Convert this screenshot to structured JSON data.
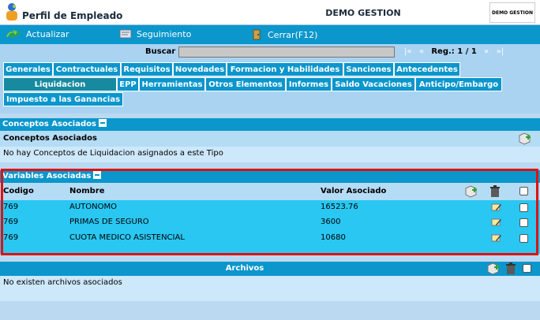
{
  "header": {
    "title": "Perfil de Empleado",
    "company": "DEMO GESTION",
    "brand_text": "DEMO GESTION"
  },
  "toolbar": {
    "actualizar": "Actualizar",
    "seguimiento": "Seguimiento",
    "cerrar": "Cerrar(F12)"
  },
  "search": {
    "label": "Buscar",
    "value": "",
    "record_label": "Reg.: 1 / 1",
    "first": "|«",
    "prev": "«",
    "next": "»",
    "last": "»|"
  },
  "tabs_row1": [
    "Generales",
    "Contractuales",
    "Requisitos",
    "Novedades",
    "Formacion y Habilidades",
    "Sanciones",
    "Antecedentes"
  ],
  "tabs_row2": [
    "Liquidacion",
    "EPP",
    "Herramientas",
    "Otros Elementos",
    "Informes",
    "Saldo Vacaciones",
    "Anticipo/Embargo"
  ],
  "tabs_row3": [
    "Impuesto a las Ganancias"
  ],
  "conceptos": {
    "section_title": "Conceptos Asociados",
    "header": "Conceptos Asociados",
    "empty_message": "No hay Conceptos de Liquidacion asignados a este Tipo"
  },
  "variables": {
    "section_title": "Variables Asociadas",
    "columns": {
      "codigo": "Codigo",
      "nombre": "Nombre",
      "valor": "Valor Asociado"
    },
    "rows": [
      {
        "codigo": "769",
        "nombre": "AUTONOMO",
        "valor": "16523.76"
      },
      {
        "codigo": "769",
        "nombre": "PRIMAS DE SEGURO",
        "valor": "3600"
      },
      {
        "codigo": "769",
        "nombre": "CUOTA MEDICO ASISTENCIAL",
        "valor": "10680"
      }
    ]
  },
  "archivos": {
    "title": "Archivos",
    "empty_message": "No existen archivos asociados"
  },
  "colors": {
    "primary": "#0b96cc",
    "light": "#a9d3f1",
    "row": "#29c7f2",
    "highlight": "#e01010"
  }
}
